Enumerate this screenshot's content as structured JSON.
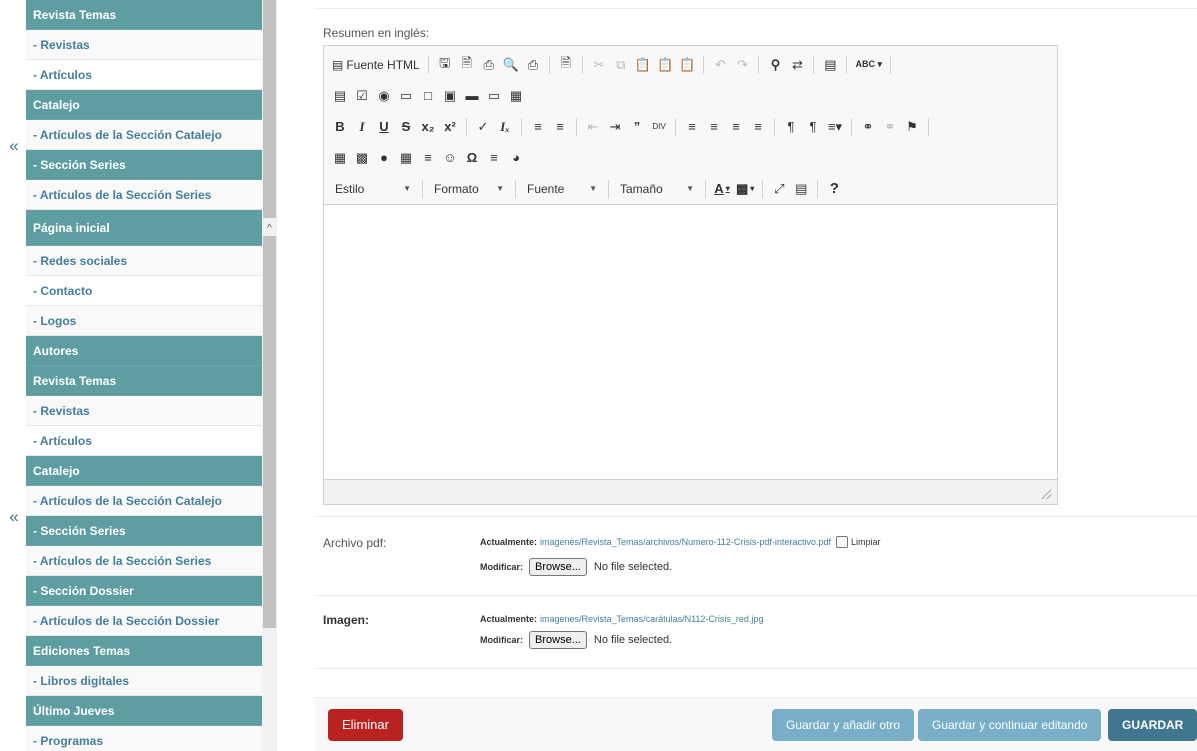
{
  "sidebar": {
    "collapse_icon": "«",
    "rows": [
      {
        "label": "Revista Temas",
        "kind": "hdr"
      },
      {
        "label": "- Revistas",
        "kind": "item"
      },
      {
        "label": "- Artículos",
        "kind": "item alt"
      },
      {
        "label": "Catalejo",
        "kind": "hdr"
      },
      {
        "label": "- Artículos de la Sección Catalejo",
        "kind": "item"
      },
      {
        "label": "- Sección Series",
        "kind": "sel"
      },
      {
        "label": "- Artículos de la Sección Series",
        "kind": "item"
      },
      {
        "label": "Página inicial",
        "kind": "hdr tall"
      },
      {
        "label": "- Redes sociales",
        "kind": "item"
      },
      {
        "label": "- Contacto",
        "kind": "item alt"
      },
      {
        "label": "- Logos",
        "kind": "item"
      },
      {
        "label": "Autores",
        "kind": "hdr"
      },
      {
        "label": "Revista Temas",
        "kind": "hdr"
      },
      {
        "label": "- Revistas",
        "kind": "item"
      },
      {
        "label": "- Artículos",
        "kind": "item alt"
      },
      {
        "label": "Catalejo",
        "kind": "hdr"
      },
      {
        "label": "- Artículos de la Sección Catalejo",
        "kind": "item"
      },
      {
        "label": "- Sección Series",
        "kind": "sel"
      },
      {
        "label": "- Artículos de la Sección Series",
        "kind": "item"
      },
      {
        "label": "- Sección Dossier",
        "kind": "sel"
      },
      {
        "label": "- Artículos de la Sección Dossier",
        "kind": "item"
      },
      {
        "label": "Ediciones Temas",
        "kind": "hdr"
      },
      {
        "label": "- Libros digitales",
        "kind": "item"
      },
      {
        "label": "Último Jueves",
        "kind": "hdr"
      },
      {
        "label": "- Programas",
        "kind": "item"
      }
    ]
  },
  "form": {
    "resumen_label": "Resumen en inglés:",
    "editor": {
      "source_label": "Fuente HTML",
      "combos": [
        "Estilo",
        "Formato",
        "Fuente",
        "Tamaño"
      ],
      "help_label": "?"
    },
    "pdf": {
      "label": "Archivo pdf:",
      "current_label": "Actualmente:",
      "current_value": "imagenes/Revista_Temas/archivos/Numero-112-Crisis-pdf-interactivo.pdf",
      "clear_label": "Limpiar",
      "change_label": "Modificar:",
      "browse_label": "Browse...",
      "no_file": "No file selected."
    },
    "imagen": {
      "label": "Imagen:",
      "current_label": "Actualmente:",
      "current_value": "imagenes/Revista_Temas/carátulas/N112-Crisis_red.jpg",
      "change_label": "Modificar:",
      "browse_label": "Browse...",
      "no_file": "No file selected."
    }
  },
  "actions": {
    "delete": "Eliminar",
    "save_add": "Guardar y añadir otro",
    "save_continue": "Guardar y continuar editando",
    "save": "GUARDAR"
  },
  "colors": {
    "sidebar_header": "#5f9ea0",
    "link": "#447e9b",
    "delete": "#ba2121",
    "secondary_button": "#79aec8",
    "primary_button": "#417690"
  }
}
